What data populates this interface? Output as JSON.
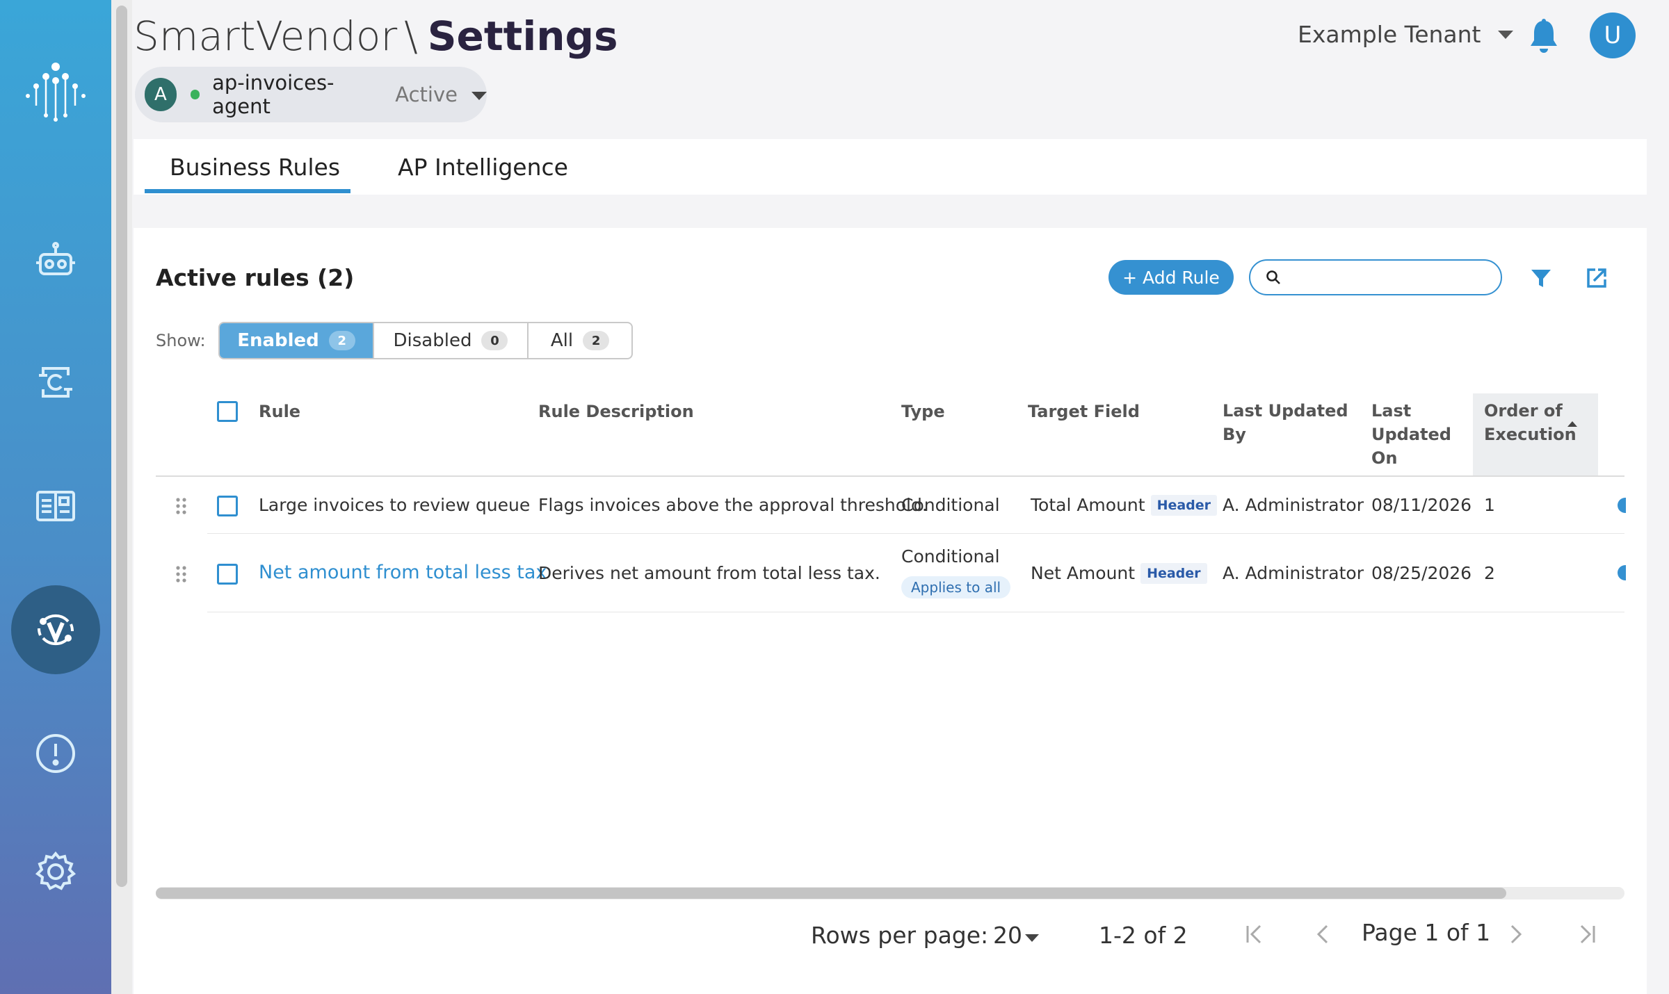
{
  "header": {
    "app_name": "SmartVendor",
    "separator": "\\",
    "page_title": "Settings",
    "tenant": "Example Tenant",
    "user_initial": "U"
  },
  "agent": {
    "avatar_initial": "A",
    "name": "ap-invoices-agent",
    "status": "Active",
    "status_color": "#3bb25c"
  },
  "sidebar": {
    "items": [
      {
        "icon": "robot-icon"
      },
      {
        "icon": "connector-icon"
      },
      {
        "icon": "book-icon"
      },
      {
        "icon": "vendor-rules-icon",
        "active": true
      },
      {
        "icon": "alert-icon"
      },
      {
        "icon": "gear-icon"
      }
    ]
  },
  "tabs": [
    {
      "label": "Business Rules",
      "active": true
    },
    {
      "label": "AP Intelligence",
      "active": false
    }
  ],
  "rules_panel": {
    "title": "Active rules (2)",
    "add_button": "+ Add Rule",
    "search_placeholder": "",
    "show_label": "Show:",
    "filters": [
      {
        "label": "Enabled",
        "count": "2",
        "active": true
      },
      {
        "label": "Disabled",
        "count": "0",
        "active": false
      },
      {
        "label": "All",
        "count": "2",
        "active": false
      }
    ]
  },
  "table": {
    "columns": {
      "rule": "Rule",
      "description": "Rule Description",
      "type": "Type",
      "target_field": "Target Field",
      "updated_by_1": "Last Updated",
      "updated_by_2": "By",
      "updated_on_1": "Last",
      "updated_on_2": "Updated",
      "updated_on_3": "On",
      "order_1": "Order of",
      "order_2": "Execution"
    },
    "rows": [
      {
        "rule": "Large invoices to review queue",
        "description": "Flags invoices above the approval threshold.",
        "type": "Conditional",
        "target_field": "Total Amount",
        "target_tag": "Header",
        "updated_by": "A. Administrator",
        "updated_on": "08/11/2026",
        "order": "1"
      },
      {
        "rule": "Net amount from total less tax",
        "description": "Derives net amount from total less tax.",
        "type": "Conditional",
        "type_chip": "Applies to all",
        "target_field": "Net Amount",
        "target_tag": "Header",
        "updated_by": "A. Administrator",
        "updated_on": "08/25/2026",
        "order": "2"
      }
    ]
  },
  "pagination": {
    "rows_per_page_label": "Rows per page:",
    "rows_per_page": "20",
    "range": "1-2 of 2",
    "page": "Page 1 of 1"
  },
  "colors": {
    "accent": "#2f8fd0",
    "primary_button": "#3591d1",
    "enabled_segment": "#5aa7db"
  }
}
